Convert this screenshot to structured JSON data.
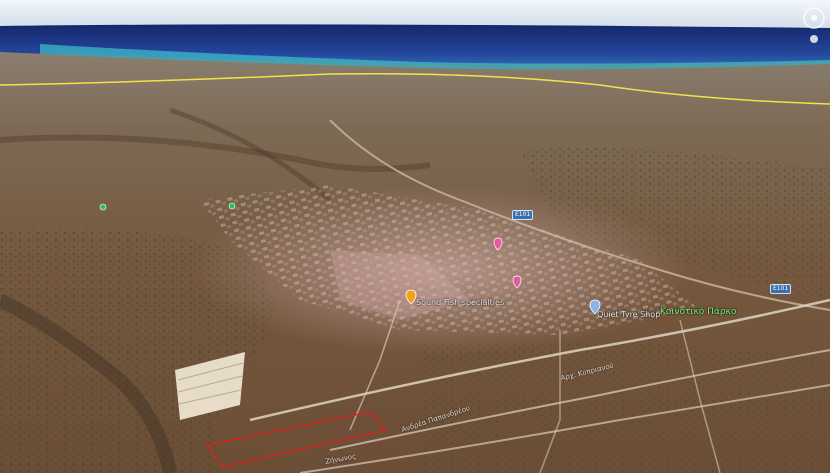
{
  "map": {
    "type": "satellite-3d-oblique",
    "colors": {
      "sky": "#e8f0f6",
      "sea": "#1f3f8f",
      "shallow_water": "#3fb8c8",
      "terrain": "#7a6247",
      "urban_overlay": "#e7c2c2",
      "border_line": "#f2e24a",
      "parcel_outline": "#e01e1e"
    }
  },
  "places": [
    {
      "name": "Sound Fish specialties",
      "icon": "orange-pin-icon"
    },
    {
      "name": "Quiet Tyre Shop",
      "icon": "info-pin-icon"
    },
    {
      "name": "Κοινοτικό Πάρκο",
      "icon": "green-park-label"
    }
  ],
  "roads": [
    {
      "name": "Ανδρέα Παπανδρέου"
    },
    {
      "name": "Αρχ. Κυπριανού"
    },
    {
      "name": "Ζήνωνος"
    }
  ],
  "shields": [
    "E101",
    "E101"
  ],
  "controls": {
    "compass_icon": "compass-icon",
    "zoom_icon": "zoom-slider-icon"
  }
}
